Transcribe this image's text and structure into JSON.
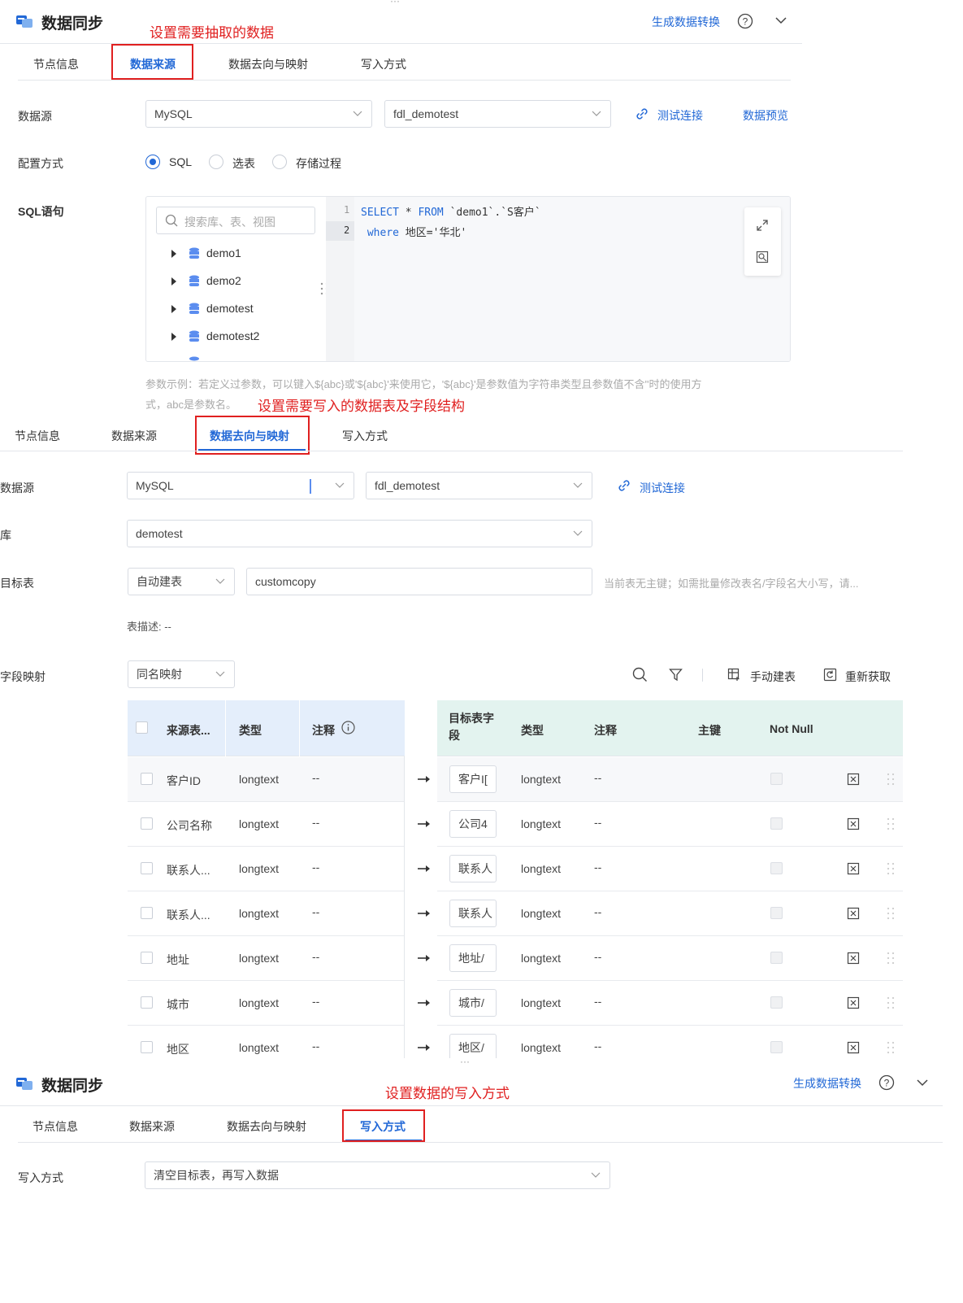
{
  "colors": {
    "brand": "#2268d6",
    "annotation": "#e02020",
    "sourceHeader": "#e4eefb",
    "targetHeader": "#e3f3ef"
  },
  "panel1": {
    "title": "数据同步",
    "generate_link": "生成数据转换",
    "annotation": "设置需要抽取的数据",
    "tabs": [
      "节点信息",
      "数据来源",
      "数据去向与映射",
      "写入方式"
    ],
    "datasource_label": "数据源",
    "datasource_type": "MySQL",
    "datasource_name": "fdl_demotest",
    "test_connection": "测试连接",
    "data_preview": "数据预览",
    "config_label": "配置方式",
    "config_options": [
      "SQL",
      "选表",
      "存储过程"
    ],
    "sql_label": "SQL语句",
    "search_placeholder": "搜索库、表、视图",
    "tree_items": [
      "demo1",
      "demo2",
      "demotest",
      "demotest2"
    ],
    "line_numbers": [
      "1",
      "2"
    ],
    "sql_line1_kw1": "SELECT",
    "sql_line1_mid": " * ",
    "sql_line1_kw2": "FROM",
    "sql_line1_rest": " `demo1`.`S客户`",
    "sql_line2_kw": "where",
    "sql_line2_rest": " 地区='华北'",
    "hint_line1": "参数示例：若定义过参数，可以键入${abc}或'${abc}'来使用它，'${abc}'是参数值为字符串类型且参数值不含''时的使用方",
    "hint_line2": "式，abc是参数名。"
  },
  "panel2": {
    "annotation": "设置需要写入的数据表及字段结构",
    "tabs": [
      "节点信息",
      "数据来源",
      "数据去向与映射",
      "写入方式"
    ],
    "datasource_label": "数据源",
    "datasource_type": "MySQL",
    "datasource_name": "fdl_demotest",
    "test_connection": "测试连接",
    "db_label": "库",
    "db_value": "demotest",
    "target_label": "目标表",
    "target_mode": "自动建表",
    "target_table": "customcopy",
    "target_hint": "当前表无主键；如需批量修改表名/字段名大小写，请...",
    "table_desc": "表描述: --",
    "mapping_label": "字段映射",
    "mapping_mode": "同名映射",
    "manual_create": "手动建表",
    "refetch": "重新获取",
    "source_headers": [
      "来源表...",
      "类型",
      "注释"
    ],
    "target_headers": [
      "目标表字段",
      "类型",
      "注释",
      "主键",
      "Not Null"
    ],
    "rows": [
      {
        "source": "客户ID",
        "type": "longtext",
        "comment": "--",
        "target": "客户I[",
        "ttype": "longtext",
        "tcomment": "--"
      },
      {
        "source": "公司名称",
        "type": "longtext",
        "comment": "--",
        "target": "公司4",
        "ttype": "longtext",
        "tcomment": "--"
      },
      {
        "source": "联系人...",
        "type": "longtext",
        "comment": "--",
        "target": "联系人",
        "ttype": "longtext",
        "tcomment": "--"
      },
      {
        "source": "联系人...",
        "type": "longtext",
        "comment": "--",
        "target": "联系人",
        "ttype": "longtext",
        "tcomment": "--"
      },
      {
        "source": "地址",
        "type": "longtext",
        "comment": "--",
        "target": "地址/",
        "ttype": "longtext",
        "tcomment": "--"
      },
      {
        "source": "城市",
        "type": "longtext",
        "comment": "--",
        "target": "城市/",
        "ttype": "longtext",
        "tcomment": "--"
      },
      {
        "source": "地区",
        "type": "longtext",
        "comment": "--",
        "target": "地区/",
        "ttype": "longtext",
        "tcomment": "--"
      }
    ]
  },
  "panel3": {
    "title": "数据同步",
    "generate_link": "生成数据转换",
    "annotation": "设置数据的写入方式",
    "tabs": [
      "节点信息",
      "数据来源",
      "数据去向与映射",
      "写入方式"
    ],
    "write_label": "写入方式",
    "write_value": "清空目标表，再写入数据"
  }
}
